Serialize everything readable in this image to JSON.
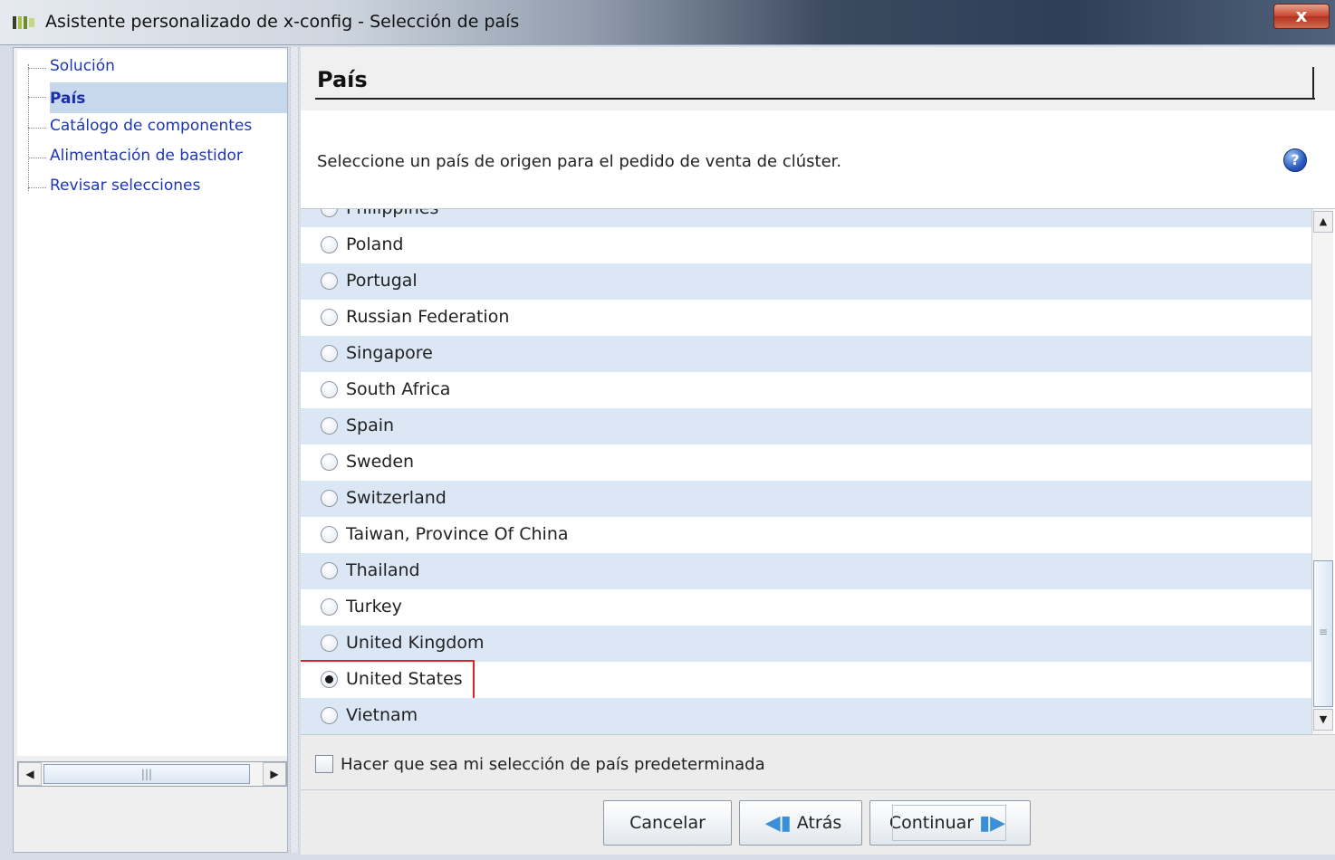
{
  "window": {
    "title": "Asistente personalizado de x-config - Selección de país",
    "close_label": "x"
  },
  "nav": {
    "items": [
      {
        "label": "Solución",
        "active": false
      },
      {
        "label": "País",
        "active": true
      },
      {
        "label": "Catálogo de componentes",
        "active": false
      },
      {
        "label": "Alimentación de bastidor",
        "active": false
      },
      {
        "label": "Revisar selecciones",
        "active": false
      }
    ],
    "scroll_thumb_glyph": "|||"
  },
  "main": {
    "title": "País",
    "description": "Seleccione un país de origen para el pedido de venta de clúster.",
    "help_icon": "help-icon",
    "countries": [
      {
        "label": "Philippines",
        "checked": false
      },
      {
        "label": "Poland",
        "checked": false
      },
      {
        "label": "Portugal",
        "checked": false
      },
      {
        "label": "Russian Federation",
        "checked": false
      },
      {
        "label": "Singapore",
        "checked": false
      },
      {
        "label": "South Africa",
        "checked": false
      },
      {
        "label": "Spain",
        "checked": false
      },
      {
        "label": "Sweden",
        "checked": false
      },
      {
        "label": "Switzerland",
        "checked": false
      },
      {
        "label": "Taiwan, Province Of China",
        "checked": false
      },
      {
        "label": "Thailand",
        "checked": false
      },
      {
        "label": "Turkey",
        "checked": false
      },
      {
        "label": "United Kingdom",
        "checked": false
      },
      {
        "label": "United States",
        "checked": true
      },
      {
        "label": "Vietnam",
        "checked": false
      }
    ],
    "selected_country": "United States",
    "default_checkbox_label": "Hacer que sea mi selección de país predeterminada",
    "default_checkbox_checked": false
  },
  "buttons": {
    "cancel": "Cancelar",
    "back": "Atrás",
    "next": "Continuar"
  },
  "colors": {
    "row_alt": "#dbe7f5",
    "nav_link": "#1c36b5",
    "highlight_border": "#d8242a"
  }
}
